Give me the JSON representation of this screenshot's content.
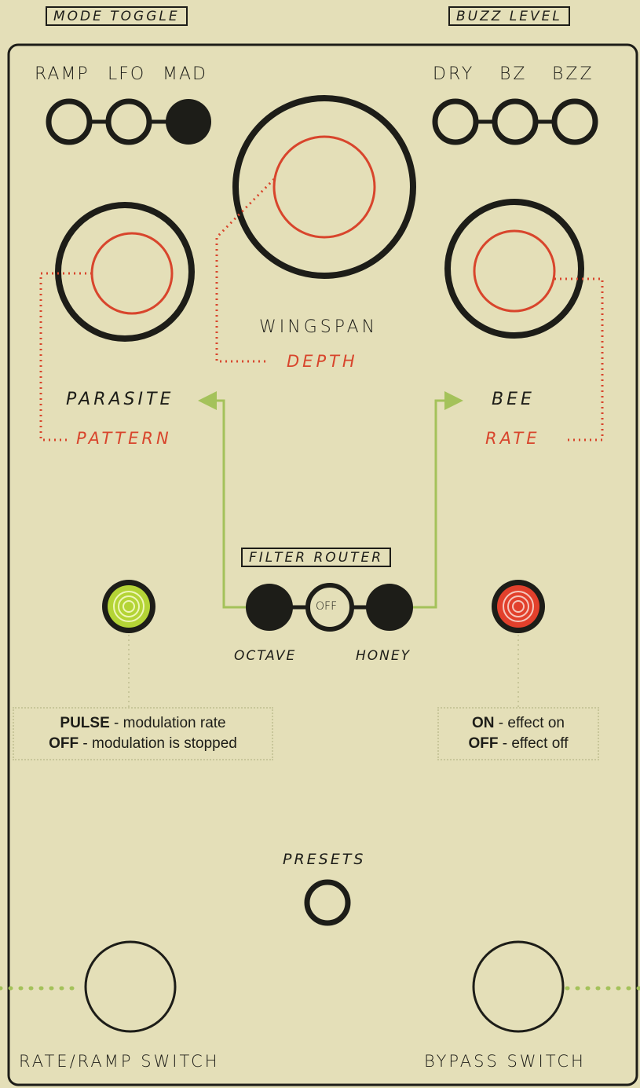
{
  "colors": {
    "background": "#e4dfb8",
    "ink": "#1d1d18",
    "accent_red": "#d8452c",
    "accent_green": "#a4c25a",
    "led_green": "#b4d436",
    "led_red": "#e2402c"
  },
  "top_tags": {
    "mode_toggle": "MODE TOGGLE",
    "buzz_level": "BUZZ LEVEL"
  },
  "mode_toggle": {
    "options": [
      "RAMP",
      "LFO",
      "MAD"
    ],
    "selected": "MAD"
  },
  "buzz_level": {
    "options": [
      "DRY",
      "BZ",
      "BZZ"
    ]
  },
  "knobs": {
    "wingspan": {
      "label": "WINGSPAN",
      "sub_label": "DEPTH"
    },
    "parasite": {
      "label": "PARASITE",
      "sub_label": "PATTERN"
    },
    "bee": {
      "label": "BEE",
      "sub_label": "RATE"
    }
  },
  "filter_router": {
    "title": "FILTER ROUTER",
    "left_label": "OCTAVE",
    "center_label": "OFF",
    "right_label": "HONEY"
  },
  "leds": {
    "pulse": {
      "line1_key": "PULSE",
      "line1_rest": " - modulation rate",
      "line2_key": "OFF",
      "line2_rest": " - modulation is stopped"
    },
    "status": {
      "line1_key": "ON",
      "line1_rest": " - effect on",
      "line2_key": "OFF",
      "line2_rest": " - effect off"
    }
  },
  "presets": {
    "label": "PRESETS"
  },
  "footswitches": {
    "left": "RATE/RAMP SWITCH",
    "right": "BYPASS SWITCH"
  }
}
